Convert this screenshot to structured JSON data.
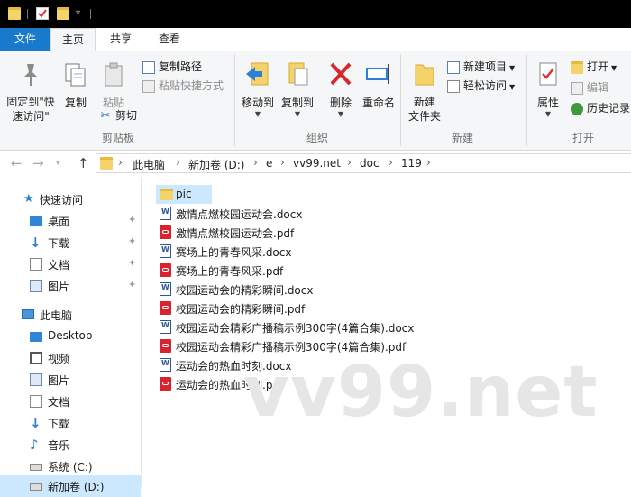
{
  "tabs": {
    "file": "文件",
    "home": "主页",
    "share": "共享",
    "view": "查看"
  },
  "ribbon": {
    "clipboard": {
      "label": "剪贴板",
      "pin_to_quick_access": "固定到\"快\n速访问\"",
      "copy": "复制",
      "paste": "粘贴",
      "copy_path": "复制路径",
      "paste_shortcut": "粘贴快捷方式",
      "cut": "剪切"
    },
    "organize": {
      "label": "组织",
      "move_to": "移动到",
      "copy_to": "复制到",
      "delete": "删除",
      "rename": "重命名"
    },
    "new": {
      "label": "新建",
      "new_folder": "新建\n文件夹",
      "new_item": "新建项目",
      "easy_access": "轻松访问"
    },
    "open": {
      "label": "打开",
      "properties": "属性",
      "open": "打开",
      "edit": "编辑",
      "history": "历史记录"
    }
  },
  "breadcrumb": [
    "此电脑",
    "新加卷 (D:)",
    "e",
    "vv99.net",
    "doc",
    "119"
  ],
  "sidebar": {
    "quick_access": "快速访问",
    "quick_items": [
      "桌面",
      "下载",
      "文档",
      "图片"
    ],
    "this_pc": "此电脑",
    "pc_items": [
      "Desktop",
      "视频",
      "图片",
      "文档",
      "下载",
      "音乐",
      "系统 (C:)",
      "新加卷 (D:)"
    ]
  },
  "files": [
    {
      "name": "pic",
      "type": "folder"
    },
    {
      "name": "激情点燃校园运动会.docx",
      "type": "docx"
    },
    {
      "name": "激情点燃校园运动会.pdf",
      "type": "pdf"
    },
    {
      "name": "赛场上的青春风采.docx",
      "type": "docx"
    },
    {
      "name": "赛场上的青春风采.pdf",
      "type": "pdf"
    },
    {
      "name": "校园运动会的精彩瞬间.docx",
      "type": "docx"
    },
    {
      "name": "校园运动会的精彩瞬间.pdf",
      "type": "pdf"
    },
    {
      "name": "校园运动会精彩广播稿示例300字(4篇合集).docx",
      "type": "docx"
    },
    {
      "name": "校园运动会精彩广播稿示例300字(4篇合集).pdf",
      "type": "pdf"
    },
    {
      "name": "运动会的热血时刻.docx",
      "type": "docx"
    },
    {
      "name": "运动会的热血时刻.pdf",
      "type": "pdf"
    }
  ],
  "watermark": "vv99.net",
  "colors": {
    "accent": "#1979ca",
    "selection": "#cce8ff",
    "ribbon_bg": "#f5f6f7",
    "titlebar": "#000000"
  }
}
